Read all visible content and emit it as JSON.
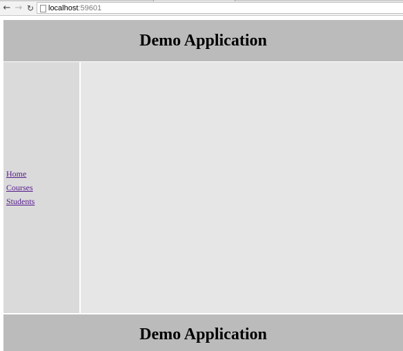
{
  "browser": {
    "url_host": "localhost",
    "url_port": ":59601",
    "icons": [
      "back-arrow",
      "forward-arrow",
      "reload",
      "page"
    ]
  },
  "header": {
    "title": "Demo Application"
  },
  "sidebar": {
    "items": [
      {
        "label": "Home"
      },
      {
        "label": "Courses"
      },
      {
        "label": "Students"
      }
    ]
  },
  "footer": {
    "title": "Demo Application"
  },
  "colors": {
    "header_bg": "#bbbbbb",
    "sidebar_bg": "#dadada",
    "main_bg": "#e6e6e6",
    "link_visited": "#551a8b"
  }
}
